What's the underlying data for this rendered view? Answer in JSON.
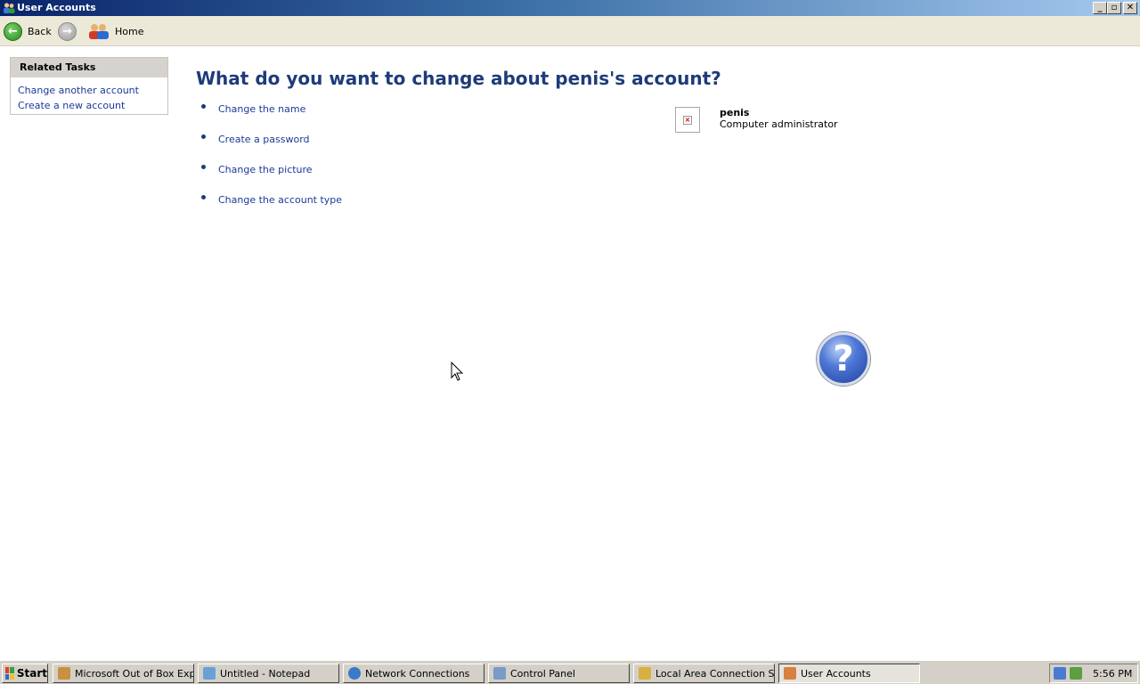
{
  "window": {
    "title": "User Accounts",
    "controls": {
      "minimize": "_",
      "maximize": "▫",
      "close": "✕"
    }
  },
  "toolbar": {
    "back_label": "Back",
    "home_label": "Home"
  },
  "related_tasks": {
    "heading": "Related Tasks",
    "links": [
      "Change another account",
      "Create a new account"
    ]
  },
  "main": {
    "heading": "What do you want to change about penis's account?",
    "tasks": [
      "Change the name",
      "Create a password",
      "Change the picture",
      "Change the account type"
    ],
    "account": {
      "name": "penis",
      "type": "Computer administrator"
    },
    "help_icon": "question-mark-icon"
  },
  "taskbar": {
    "start_label": "Start",
    "buttons": [
      "Microsoft Out of Box Exp...",
      "Untitled - Notepad",
      "Network Connections",
      "Control Panel",
      "Local Area Connection St...",
      "User Accounts"
    ],
    "clock": "5:56 PM"
  },
  "colors": {
    "link": "#1a3a9a",
    "heading": "#1e3b7a",
    "titlebar_start": "#0a246a",
    "taskbar": "#d4d0c8"
  }
}
